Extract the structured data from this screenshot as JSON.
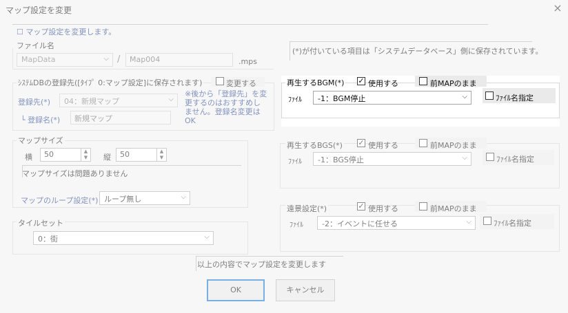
{
  "window": {
    "title": "マップ設定を変更",
    "close_glyph": "×"
  },
  "header_note": "☐ マップ設定を変更します。",
  "file": {
    "label": "ファイル名",
    "folder": "MapData",
    "sep": "/",
    "name": "Map004",
    "ext": ".mps"
  },
  "info_note": "(*)が付いている項目は「システムデータベース」側に保存されています。",
  "sysdb": {
    "label": "ｼｽﾃﾑDBの登録先([ﾀｲﾌﾟ 0:マップ設定]に保存されます)",
    "change_label": "変更する",
    "dest_label": "登録先(*)",
    "dest_value": "04：新規マップ",
    "regname_label": "└ 登録名(*)",
    "regname_value": "新規マップ",
    "warning": "※後から「登録先」を変更するのはおすすめしません。登録名変更はOK"
  },
  "mapsize": {
    "label": "マップサイズ",
    "w_label": "横",
    "w_value": "50",
    "h_label": "縦",
    "h_value": "50",
    "note": "マップサイズは問題ありません",
    "loop_label": "マップのループ設定(*)",
    "loop_value": "ループ無し"
  },
  "tileset": {
    "label": "タイルセット",
    "value": "0：街"
  },
  "bgm": {
    "label": "再生するBGM(*)",
    "use_label": "使用する",
    "keep_label": "前MAPのまま",
    "file_label": "ﾌｧｲﾙ",
    "file_value": "-1：BGM停止",
    "filename_label": "ﾌｧｲﾙ名指定"
  },
  "bgs": {
    "label": "再生するBGS(*)",
    "use_label": "使用する",
    "keep_label": "前MAPのまま",
    "file_label": "ﾌｧｲﾙ",
    "file_value": "-1：BGS停止",
    "filename_label": "ﾌｧｲﾙ名指定"
  },
  "bg": {
    "label": "遠景設定(*)",
    "use_label": "使用する",
    "keep_label": "前MAPのまま",
    "file_label": "ﾌｧｲﾙ",
    "file_value": "-2：イベントに任せる",
    "filename_label": "ﾌｧｲﾙ名指定"
  },
  "footer_note": "以上の内容でマップ設定を変更します",
  "buttons": {
    "ok": "OK",
    "cancel": "キャンセル"
  },
  "glyphs": {
    "check": "✓",
    "down": "⌵",
    "up_small": "▲",
    "down_small": "▼"
  }
}
